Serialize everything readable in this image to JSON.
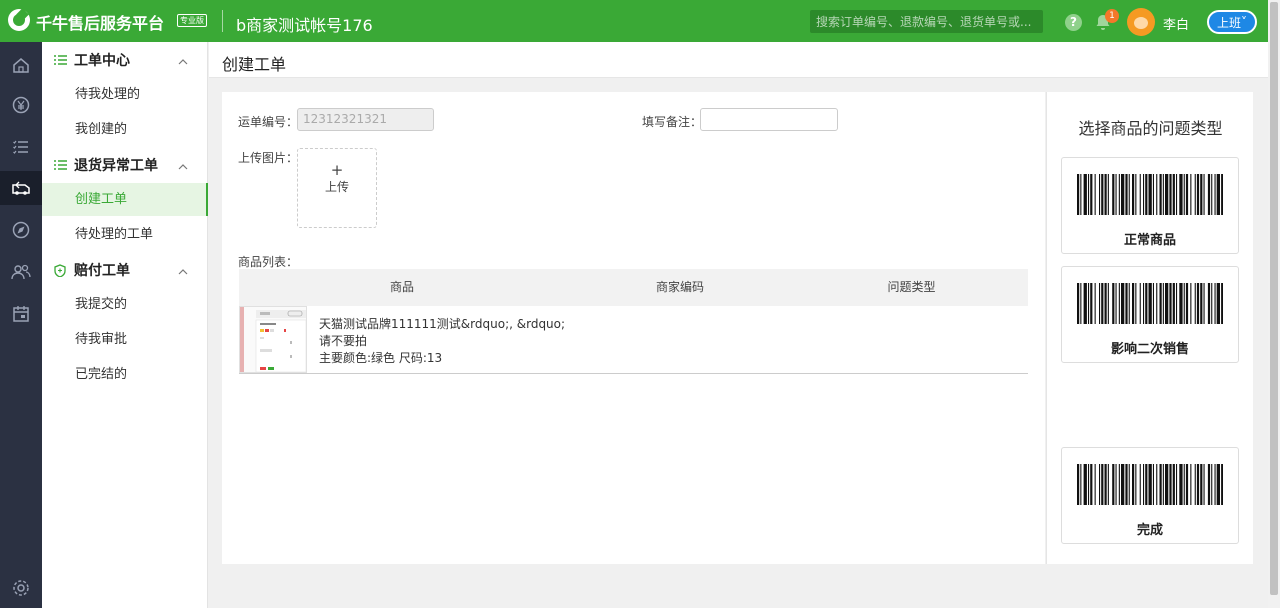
{
  "header": {
    "brand": "千牛售后服务平台",
    "edition_badge": "专业版",
    "account": "b商家测试帐号176",
    "search_placeholder": "搜索订单编号、退款编号、退货单号或...",
    "help_glyph": "?",
    "notification_count": "1",
    "user_name": "李白",
    "shift_button": "上班",
    "brand_color": "#3aa936"
  },
  "rail_icons": [
    "home-icon",
    "yuan-icon",
    "list-icon",
    "return-icon",
    "compass-icon",
    "people-icon",
    "calendar-icon",
    "settings-icon"
  ],
  "sidebar": {
    "groups": [
      {
        "label": "工单中心",
        "items": [
          "待我处理的",
          "我创建的"
        ]
      },
      {
        "label": "退货异常工单",
        "items": [
          "创建工单",
          "待处理的工单"
        ]
      },
      {
        "label": "赔付工单",
        "items": [
          "我提交的",
          "待我审批",
          "已完结的"
        ]
      }
    ],
    "active_item": "创建工单"
  },
  "page": {
    "title": "创建工单"
  },
  "form": {
    "waybill_label": "运单编号：",
    "waybill_value": "12312321321",
    "remark_label": "填写备注：",
    "remark_value": "",
    "upload_label": "上传图片：",
    "upload_plus": "+",
    "upload_text": "上传",
    "product_list_label": "商品列表："
  },
  "product_table": {
    "columns": [
      "商品",
      "商家编码",
      "问题类型"
    ],
    "rows": [
      {
        "name_line1": "天猫测试品牌111111测试&rdquo;, &rdquo;",
        "name_line2": "请不要拍",
        "spec": "主要颜色:绿色 尺码:13",
        "merchant_code": "",
        "problem_type": ""
      }
    ]
  },
  "issue_panel": {
    "title": "选择商品的问题类型",
    "options": [
      "正常商品",
      "影响二次销售",
      "完成"
    ]
  }
}
